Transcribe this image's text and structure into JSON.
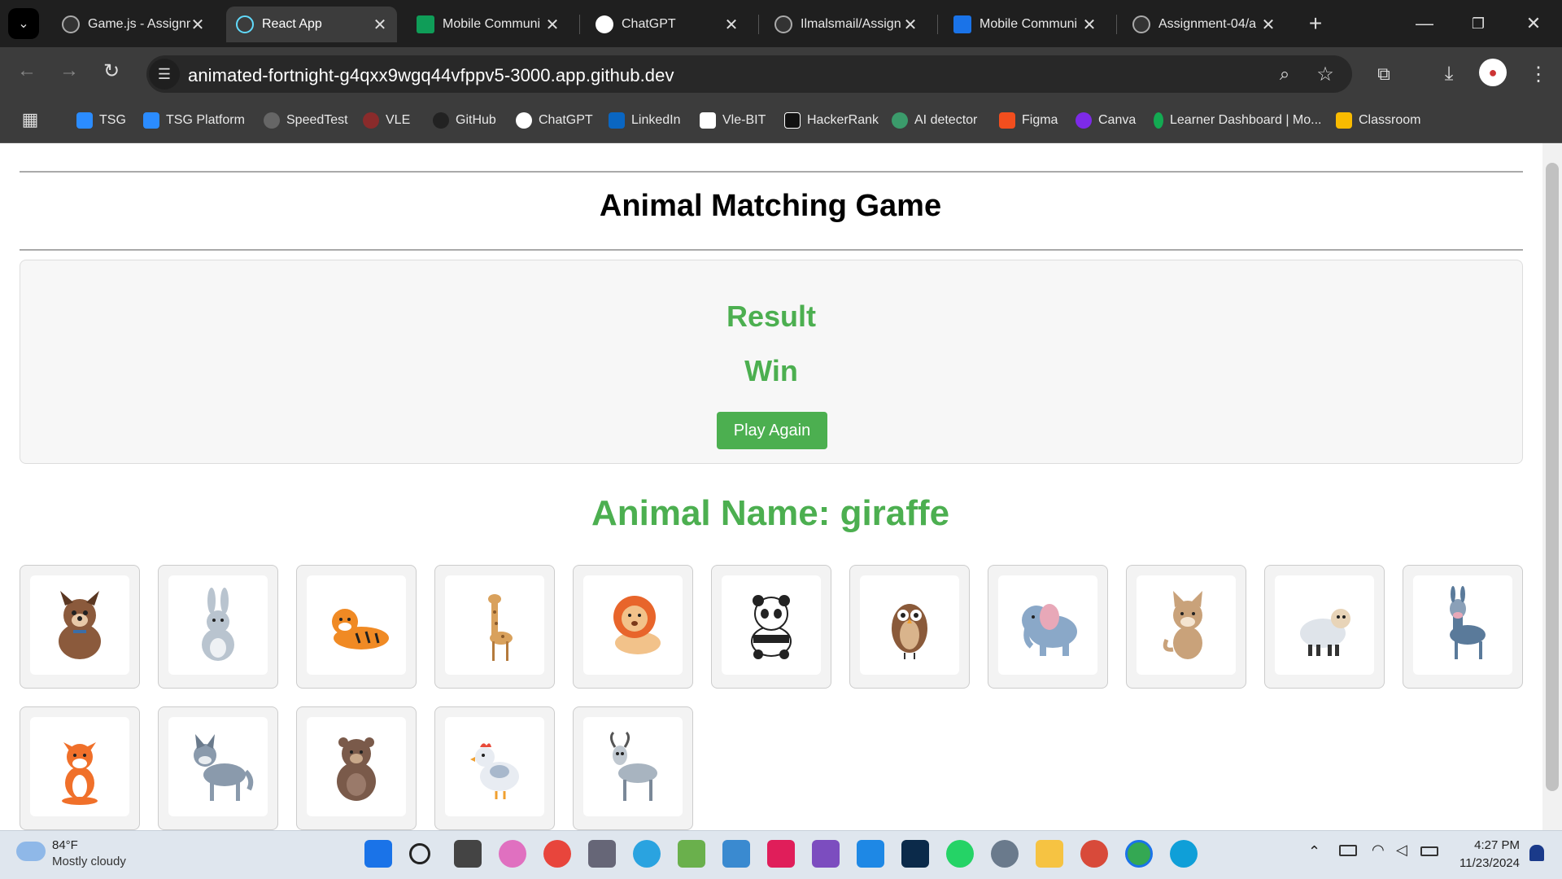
{
  "browser": {
    "tabs": [
      {
        "label": "Game.js - Assignm",
        "active": false,
        "icon": "github-icon"
      },
      {
        "label": "React App",
        "active": true,
        "icon": "react-icon"
      },
      {
        "label": "Mobile Communi",
        "active": false,
        "icon": "sheets-icon"
      },
      {
        "label": "ChatGPT",
        "active": false,
        "icon": "chatgpt-icon"
      },
      {
        "label": "Ilmalsmail/Assign",
        "active": false,
        "icon": "github-icon"
      },
      {
        "label": "Mobile Communi",
        "active": false,
        "icon": "contacts-icon"
      },
      {
        "label": "Assignment-04/a",
        "active": false,
        "icon": "github-icon"
      }
    ],
    "close_glyph": "✕",
    "new_tab_glyph": "+",
    "url": "animated-fortnight-g4qxx9wgq44vfppv5-3000.app.github.dev",
    "bookmarks": [
      {
        "label": "TSG",
        "color": "#2b8cff"
      },
      {
        "label": "TSG Platform",
        "color": "#2b8cff"
      },
      {
        "label": "SpeedTest",
        "color": "#666666"
      },
      {
        "label": "VLE",
        "color": "#8a2b2b"
      },
      {
        "label": "GitHub",
        "color": "#222222"
      },
      {
        "label": "ChatGPT",
        "color": "#ffffff"
      },
      {
        "label": "LinkedIn",
        "color": "#0a66c2"
      },
      {
        "label": "Vle-BIT",
        "color": "#ffffff"
      },
      {
        "label": "HackerRank",
        "color": "#111111"
      },
      {
        "label": "AI detector",
        "color": "#3b9b6b"
      },
      {
        "label": "Figma",
        "color": "#f24e1e"
      },
      {
        "label": "Canva",
        "color": "#7d2ae8"
      },
      {
        "label": "Learner Dashboard | Mo...",
        "color": "#13aa52"
      },
      {
        "label": "Classroom",
        "color": "#f9bb00"
      }
    ]
  },
  "page": {
    "title": "Animal Matching Game",
    "result_heading": "Result",
    "result_value": "Win",
    "play_again_label": "Play Again",
    "animal_name_text": "Animal Name: giraffe",
    "accent_color": "#4caf50",
    "animals": [
      "dog",
      "rabbit",
      "tiger",
      "giraffe",
      "lion",
      "panda",
      "owl",
      "elephant",
      "cat",
      "sheep",
      "donkey",
      "fox",
      "wolf",
      "bear",
      "hen",
      "goat"
    ]
  },
  "taskbar": {
    "weather_temp": "84°F",
    "weather_desc": "Mostly cloudy",
    "time": "4:27 PM",
    "date": "11/23/2024"
  }
}
